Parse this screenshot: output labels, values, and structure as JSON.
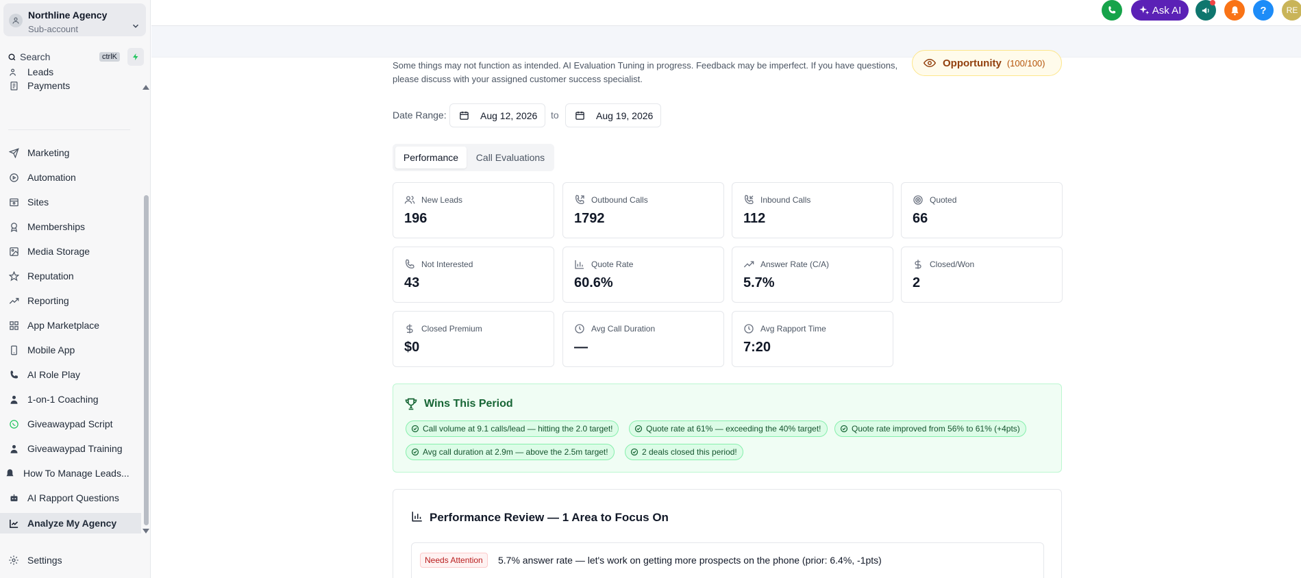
{
  "account": {
    "name": "Northline Agency",
    "type": "Sub-account"
  },
  "search": {
    "label": "Search",
    "shortcut": "ctrlK"
  },
  "sidebar": {
    "items": [
      {
        "label": "Leads",
        "icon": "users-icon"
      },
      {
        "label": "Payments",
        "icon": "receipt-icon"
      },
      {
        "label": "Marketing",
        "icon": "send-icon"
      },
      {
        "label": "Automation",
        "icon": "automation-icon"
      },
      {
        "label": "Sites",
        "icon": "browser-icon"
      },
      {
        "label": "Memberships",
        "icon": "award-icon"
      },
      {
        "label": "Media Storage",
        "icon": "image-icon"
      },
      {
        "label": "Reputation",
        "icon": "star-icon"
      },
      {
        "label": "Reporting",
        "icon": "trend-icon"
      },
      {
        "label": "App Marketplace",
        "icon": "grid-icon"
      },
      {
        "label": "Mobile App",
        "icon": "phone-device-icon"
      },
      {
        "label": "AI Role Play",
        "icon": "phone-call-icon"
      },
      {
        "label": "1-on-1 Coaching",
        "icon": "person-icon"
      },
      {
        "label": "Giveawaypad Script",
        "icon": "whatsapp-icon"
      },
      {
        "label": "Giveawaypad Training",
        "icon": "person-icon"
      },
      {
        "label": "How To Manage Leads...",
        "icon": "bell-icon"
      },
      {
        "label": "AI Rapport Questions",
        "icon": "robot-icon"
      },
      {
        "label": "Analyze My Agency",
        "icon": "chart-line-icon"
      }
    ],
    "settings": "Settings"
  },
  "header": {
    "ask_ai": "Ask AI",
    "help": "?",
    "user_initials": "RE"
  },
  "notice": "Some things may not function as intended. AI Evaluation Tuning in progress. Feedback may be imperfect. If you have questions, please discuss with your assigned customer success specialist.",
  "opportunity": {
    "label": "Opportunity",
    "score": "(100/100)"
  },
  "date_range": {
    "label": "Date Range:",
    "from": "Aug 12, 2026",
    "to_label": "to",
    "to": "Aug 19, 2026"
  },
  "tabs": {
    "performance": "Performance",
    "call_evaluations": "Call Evaluations"
  },
  "metrics": [
    {
      "label": "New Leads",
      "value": "196"
    },
    {
      "label": "Outbound Calls",
      "value": "1792"
    },
    {
      "label": "Inbound Calls",
      "value": "112"
    },
    {
      "label": "Quoted",
      "value": "66"
    },
    {
      "label": "Not Interested",
      "value": "43"
    },
    {
      "label": "Quote Rate",
      "value": "60.6%"
    },
    {
      "label": "Answer Rate (C/A)",
      "value": "5.7%"
    },
    {
      "label": "Closed/Won",
      "value": "2"
    },
    {
      "label": "Closed Premium",
      "value": "$0"
    },
    {
      "label": "Avg Call Duration",
      "value": "—"
    },
    {
      "label": "Avg Rapport Time",
      "value": "7:20"
    }
  ],
  "wins": {
    "title": "Wins This Period",
    "items": [
      "Call volume at 9.1 calls/lead — hitting the 2.0 target!",
      "Quote rate at 61% — exceeding the 40% target!",
      "Quote rate improved from 56% to 61% (+4pts)",
      "Avg call duration at 2.9m — above the 2.5m target!",
      "2 deals closed this period!"
    ]
  },
  "review": {
    "title": "Performance Review — 1 Area to Focus On",
    "items": [
      {
        "badge": "Needs Attention",
        "text": "5.7% answer rate — let's work on getting more prospects on the phone (prior: 6.4%, -1pts)"
      }
    ]
  },
  "colors": {
    "phone_green": "#16a34a",
    "ask_ai_purple": "#5b21b6",
    "teal": "#0f766e",
    "orange": "#f97316",
    "blue": "#1d8cf8",
    "avatar_gold": "#c9b458"
  }
}
